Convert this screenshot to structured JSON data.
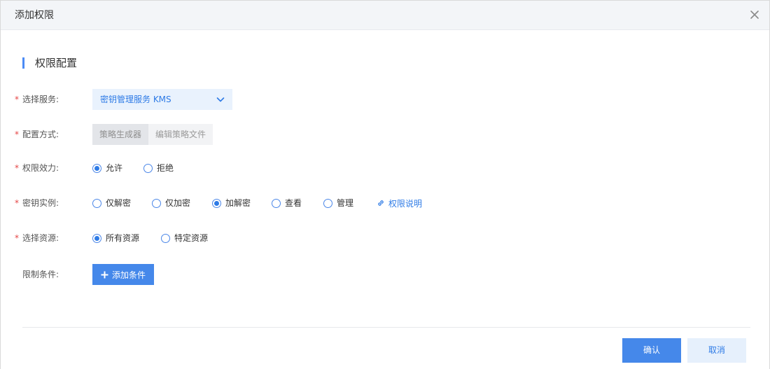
{
  "dialog": {
    "title": "添加权限",
    "close_icon": "close-icon"
  },
  "section": {
    "title": "权限配置"
  },
  "form": {
    "service": {
      "label": "选择服务:",
      "value": "密钥管理服务 KMS",
      "icon": "chevron-down-icon"
    },
    "config_mode": {
      "label": "配置方式:",
      "options": [
        "策略生成器",
        "编辑策略文件"
      ],
      "selected": "策略生成器"
    },
    "effect": {
      "label": "权限效力:",
      "options": [
        "允许",
        "拒绝"
      ],
      "selected": "允许"
    },
    "key_instance": {
      "label": "密钥实例:",
      "options": [
        "仅解密",
        "仅加密",
        "加解密",
        "查看",
        "管理"
      ],
      "selected": "加解密",
      "help_link": "权限说明",
      "help_icon": "link-icon"
    },
    "resource": {
      "label": "选择资源:",
      "options": [
        "所有资源",
        "特定资源"
      ],
      "selected": "所有资源"
    },
    "conditions": {
      "label": "限制条件:",
      "add_button": "添加条件",
      "add_icon": "plus-icon"
    },
    "required_mark": "*"
  },
  "footer": {
    "confirm": "确认",
    "cancel": "取消"
  },
  "colors": {
    "accent": "#4588ea",
    "link": "#2e7be6",
    "required": "#e54545",
    "select_bg": "#e9f2fd"
  }
}
